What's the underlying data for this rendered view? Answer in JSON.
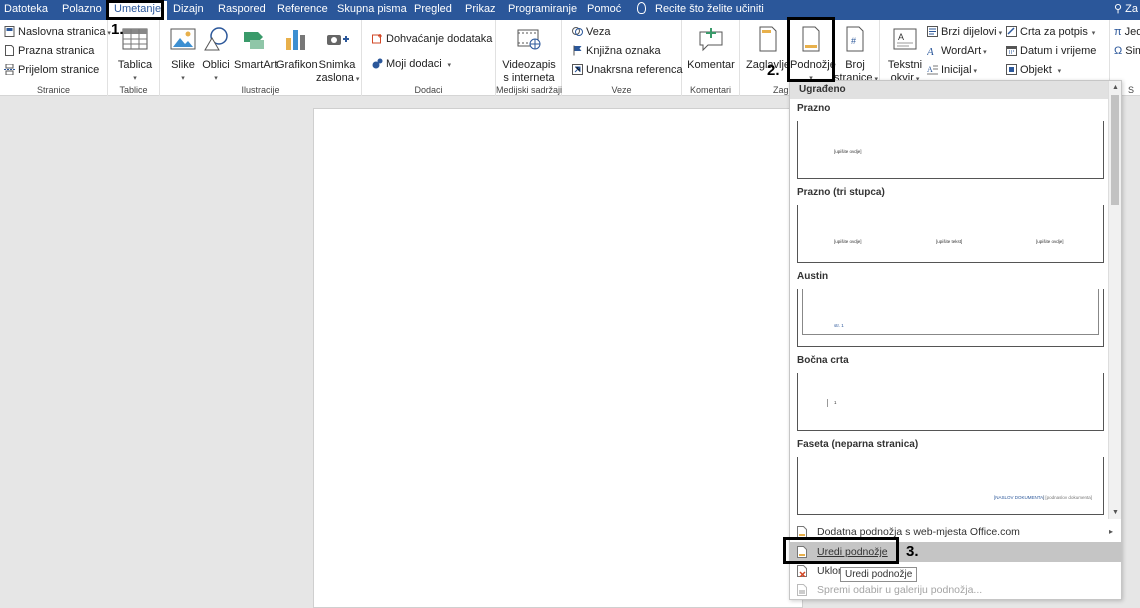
{
  "tabs": [
    "Datoteka",
    "Polazno",
    "Umetanje",
    "Dizajn",
    "Raspored",
    "Reference",
    "Skupna pisma",
    "Pregled",
    "Prikaz",
    "Programiranje",
    "Pomoć"
  ],
  "tell_me": "Recite što želite učiniti",
  "user_initials": "Za",
  "colors": {
    "ribbon_blue": "#2b579a",
    "highlight": "#c5c5c5",
    "outline": "#000000"
  },
  "groups": {
    "stranice": {
      "label": "Stranice",
      "items": [
        "Naslovna stranica",
        "Prazna stranica",
        "Prijelom stranice"
      ]
    },
    "tablice": {
      "label": "Tablice",
      "table": "Tablica"
    },
    "ilustracije": {
      "label": "Ilustracije",
      "slike": "Slike",
      "oblici": "Oblici",
      "smartart": "SmartArt",
      "grafikon": "Grafikon",
      "snimka1": "Snimka",
      "snimka2": "zaslona"
    },
    "dodaci": {
      "label": "Dodaci",
      "get": "Dohvaćanje dodataka",
      "mine": "Moji dodaci"
    },
    "mediji": {
      "label": "Medijski sadržaji",
      "video1": "Videozapis",
      "video2": "s interneta"
    },
    "veze": {
      "label": "Veze",
      "veza": "Veza",
      "knjizna": "Knjižna oznaka",
      "unakrsna": "Unakrsna referenca"
    },
    "komentari": {
      "label": "Komentari",
      "komentar": "Komentar"
    },
    "zaglavlje": {
      "label": "Zagl",
      "zaglavlje": "Zaglavlje",
      "podnozje": "Podnožje",
      "broj1": "Broj",
      "broj2": "stranice"
    },
    "tekst": {
      "okvir1": "Tekstni",
      "okvir2": "okvir",
      "brzi": "Brzi dijelovi",
      "wordart": "WordArt",
      "inicijal": "Inicijal",
      "crta": "Crta za potpis",
      "datum": "Datum i vrijeme",
      "objekt": "Objekt"
    },
    "simboli": {
      "jed": "Jed",
      "sim": "Sim",
      "s": "S"
    }
  },
  "steps": {
    "one": "1.",
    "two": "2.",
    "three": "3."
  },
  "gallery": {
    "header": "Ugrađeno",
    "items": [
      {
        "title": "Prazno",
        "texts": [
          "[upišite ovdje]"
        ]
      },
      {
        "title": "Prazno (tri stupca)",
        "texts": [
          "[upišite ovdje]",
          "[upišite tekst]",
          "[upišite ovdje]"
        ]
      },
      {
        "title": "Austin",
        "texts": [
          "str. 1"
        ]
      },
      {
        "title": "Bočna crta",
        "texts": [
          "1"
        ]
      },
      {
        "title": "Faseta (neparna stranica)",
        "texts": [
          "[NASLOV DOKUMENTA]",
          "|  [podnaslov dokumenta]"
        ]
      }
    ],
    "menu": [
      {
        "label": "Dodatna podnožja s web-mjesta Office.com"
      },
      {
        "label": "Uredi podnožje"
      },
      {
        "label": "Uklon"
      },
      {
        "label": "Spremi odabir u galeriju podnožja..."
      }
    ],
    "tooltip": "Uredi podnožje"
  }
}
